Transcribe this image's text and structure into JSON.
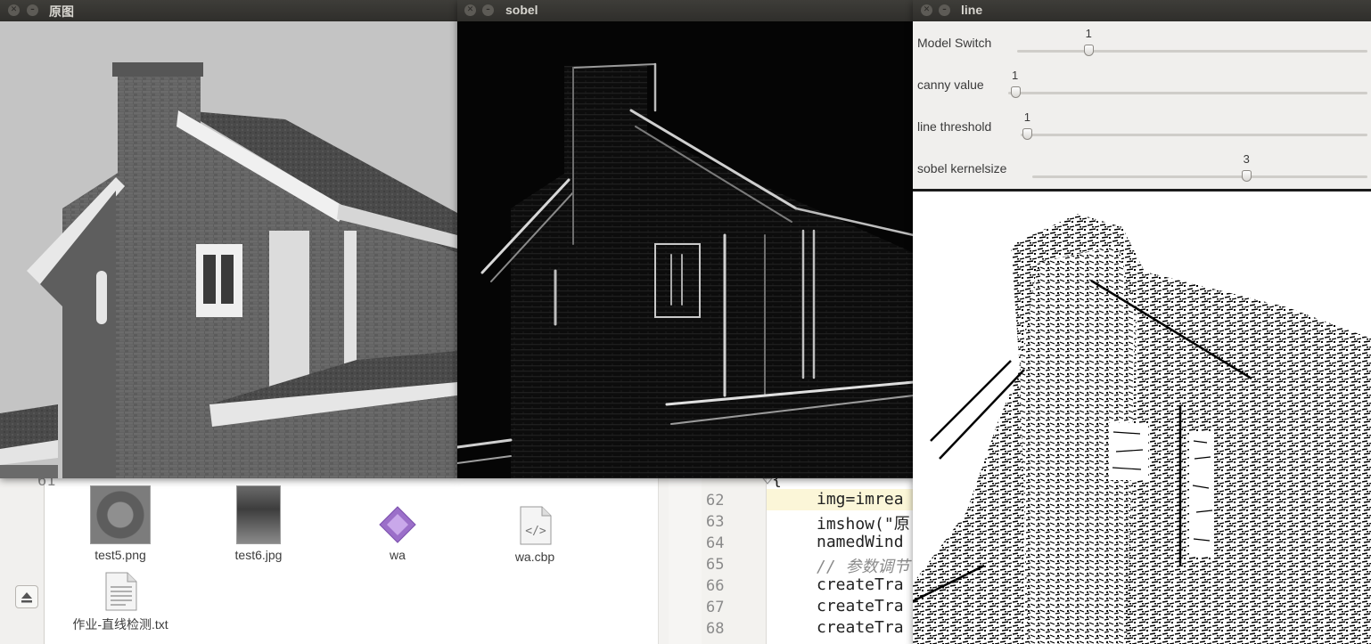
{
  "file_manager": {
    "files": [
      {
        "name": "test5.png",
        "icon": "png-thumbnail-icon"
      },
      {
        "name": "test6.jpg",
        "icon": "jpg-thumbnail-icon"
      },
      {
        "name": "wa",
        "icon": "executable-icon"
      },
      {
        "name": "wa.cbp",
        "icon": "xml-file-icon"
      },
      {
        "name": "作业-直线检测.txt",
        "icon": "text-file-icon"
      }
    ]
  },
  "editor": {
    "lines": [
      {
        "num": "61",
        "code": "{"
      },
      {
        "num": "62",
        "code": "img=imrea"
      },
      {
        "num": "63",
        "code": "imshow(\"原"
      },
      {
        "num": "64",
        "code": "namedWind"
      },
      {
        "num": "65",
        "code": "// 参数调节"
      },
      {
        "num": "66",
        "code": "createTra"
      },
      {
        "num": "67",
        "code": "createTra"
      },
      {
        "num": "68",
        "code": "createTra"
      }
    ]
  },
  "windows": {
    "original": {
      "title": "原图"
    },
    "sobel": {
      "title": "sobel"
    },
    "line": {
      "title": "line"
    }
  },
  "trackbars": [
    {
      "label": "Model Switch",
      "value": "1",
      "fraction": 0.205
    },
    {
      "label": "canny value",
      "value": "1",
      "fraction": 0.02
    },
    {
      "label": "line threshold",
      "value": "1",
      "fraction": 0.02
    },
    {
      "label": "sobel kernelsize",
      "value": "3",
      "fraction": 0.64
    }
  ],
  "colors": {
    "titlebar": "#2f2e2b",
    "panel": "#f0efed",
    "sobel_bg": "#050505"
  }
}
